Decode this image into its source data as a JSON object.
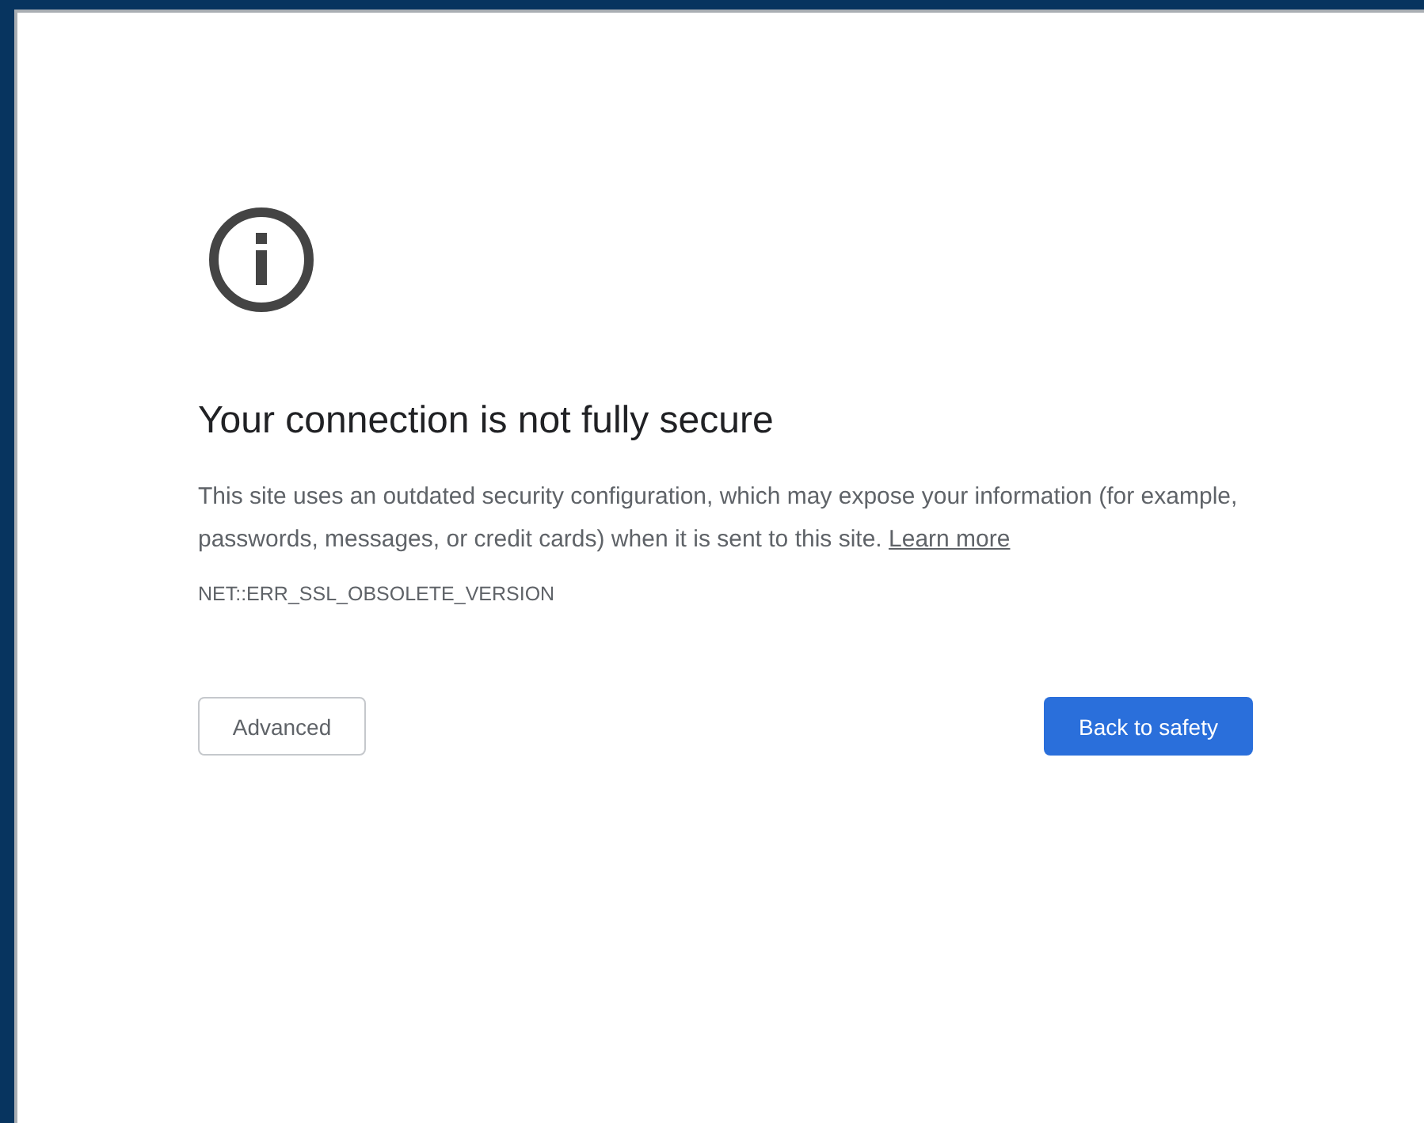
{
  "heading": "Your connection is not fully secure",
  "message": {
    "text": "This site uses an outdated security configuration, which may expose your information (for example, passwords, messages, or credit cards) when it is sent to this site.",
    "link": "Learn more"
  },
  "error_code": "NET::ERR_SSL_OBSOLETE_VERSION",
  "buttons": [
    {
      "label": "Advanced",
      "kind": "secondary"
    },
    {
      "label": "Back to safety",
      "kind": "primary"
    }
  ]
}
